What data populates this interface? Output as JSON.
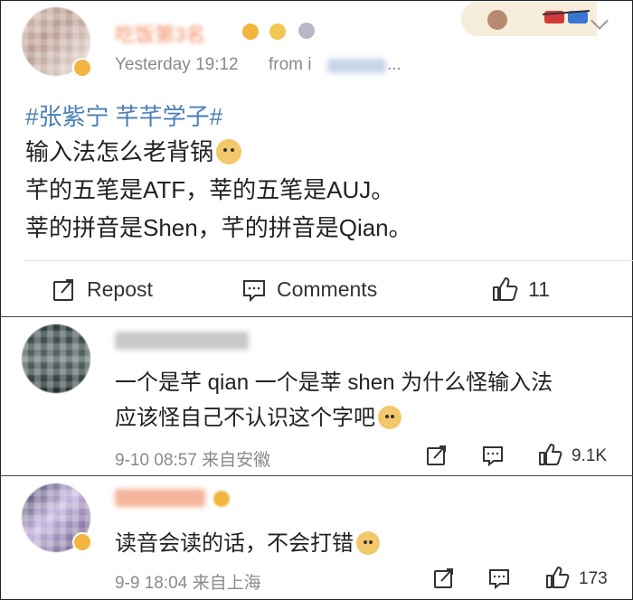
{
  "post": {
    "username": "吃饭第3名",
    "timestamp": "Yesterday 19:12",
    "source_prefix": "from i",
    "source_ellipsis": "...",
    "topic": "#张紫宁 芊芊学子#",
    "lines": [
      "输入法怎么老背锅",
      "芊的五笔是ATF，莘的五笔是AUJ。",
      "莘的拼音是Shen，芊的拼音是Qian。"
    ],
    "emoji_name": "doge-emoji",
    "actions": {
      "repost_label": "Repost",
      "comments_label": "Comments",
      "like_count": "11"
    },
    "colors": {
      "topic": "#4a7fb6",
      "meta": "#8a8a8a",
      "badge": "#f2b640"
    }
  },
  "comments": [
    {
      "text_lines": [
        "一个是芊 qian 一个是莘 shen 为什么怪输入法",
        "应该怪自己不认识这个字吧"
      ],
      "emoji_name": "upside-down-face-emoji",
      "meta": "9-10 08:57 来自安徽",
      "like_count": "9.1K"
    },
    {
      "text_lines": [
        "读音会读的话，不会打错"
      ],
      "emoji_name": "doge-emoji",
      "meta": "9-9 18:04 来自上海",
      "like_count": "173"
    }
  ]
}
